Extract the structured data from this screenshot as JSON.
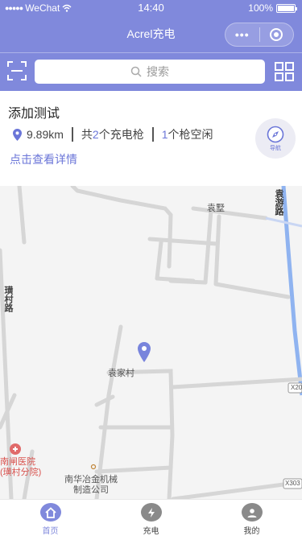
{
  "status_bar": {
    "carrier": "WeChat",
    "time": "14:40",
    "battery": "100%"
  },
  "nav": {
    "title": "Acrel充电",
    "more_label": "•••"
  },
  "search": {
    "placeholder": "搜索"
  },
  "station": {
    "name": "添加测试",
    "distance": "9.89km",
    "total_prefix": "共",
    "total_count": "2",
    "total_suffix": "个充电枪",
    "idle_count": "1",
    "idle_suffix": "个枪空闲",
    "details_link": "点击查看详情",
    "navigate_label": "导航"
  },
  "map": {
    "labels": {
      "yuanhu_road": "袁游路",
      "yuanshu": "袁墅",
      "heng_village_road": "璜村路",
      "yuanjia_village": "袁家村",
      "hospital": "南闸医院\n(璜村分院)",
      "company": "南华冶金机械\n制造公司",
      "road_x": "X20",
      "road_x303": "X303"
    }
  },
  "tabs": [
    {
      "label": "首页",
      "active": true
    },
    {
      "label": "充电",
      "active": false
    },
    {
      "label": "我的",
      "active": false
    }
  ],
  "colors": {
    "brand": "#8089dc",
    "link": "#6b76d8"
  }
}
